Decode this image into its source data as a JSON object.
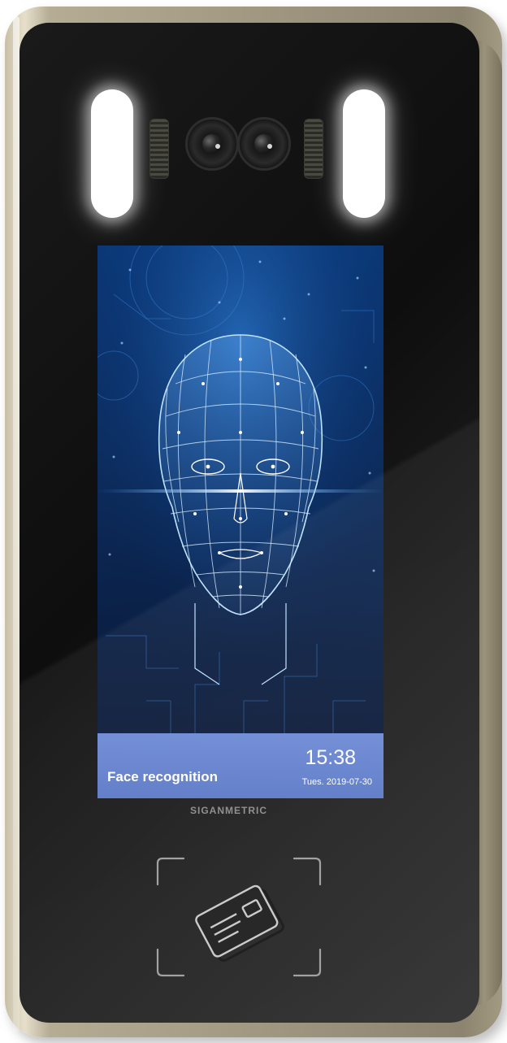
{
  "device": {
    "brand": "SIGANMETRIC",
    "body_color": "#b5ac94",
    "face_color": "#111111"
  },
  "screen": {
    "status": {
      "title": "Face recognition",
      "time": "15:38",
      "date": "Tues.  2019-07-30"
    },
    "accent_color": "#5a78c6",
    "background_color": "#0d2d5f"
  },
  "icons": {
    "camera": "camera-icon",
    "ir_light": "ir-light-icon",
    "card_reader": "card-reader-icon",
    "face_mesh": "face-mesh-icon"
  }
}
